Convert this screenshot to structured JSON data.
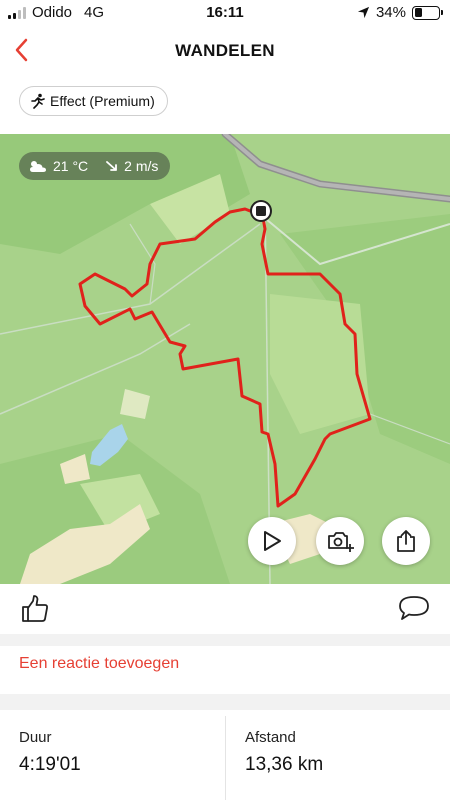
{
  "status_bar": {
    "carrier": "Odido",
    "network": "4G",
    "time": "16:11",
    "battery": "34%",
    "battery_level": 0.34
  },
  "nav": {
    "title": "WANDELEN",
    "back_icon": "chevron-left-icon"
  },
  "effect_chip": {
    "label": "Effect (Premium)",
    "icon": "runner-icon"
  },
  "map": {
    "weather": {
      "temperature": "21 °C",
      "wind": "2 m/s",
      "weather_icon": "cloud-sun-icon",
      "wind_icon": "wind-arrow-icon"
    },
    "route_color": "#e0221b",
    "buttons": [
      {
        "icon": "play-icon"
      },
      {
        "icon": "camera-add-icon"
      },
      {
        "icon": "share-icon"
      }
    ]
  },
  "actions": {
    "like_icon": "thumbs-up-icon",
    "comment_icon": "comment-icon",
    "add_comment": "Een reactie toevoegen"
  },
  "stats": {
    "duration_label": "Duur",
    "duration_value": "4:19'01",
    "distance_label": "Afstand",
    "distance_value": "13,36 km"
  },
  "colors": {
    "accent": "#e64034",
    "map_green": "#a9d38a"
  }
}
